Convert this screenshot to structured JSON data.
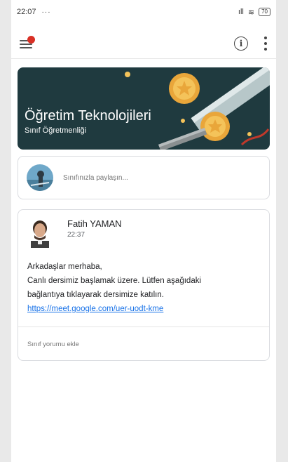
{
  "status_bar": {
    "time": "22:07",
    "dots": "···",
    "signal": "ıll",
    "wifi": "≋",
    "battery": "70"
  },
  "icons": {
    "menu": "hamburger-menu-icon",
    "info": "info-icon",
    "more": "more-vert-icon",
    "notification_color": "#d93025"
  },
  "banner": {
    "title": "Öğretim Teknolojileri",
    "subtitle": "Sınıf Öğretmenliği",
    "background": "#1f3a3f"
  },
  "share": {
    "placeholder": "Sınıfınızla paylaşın..."
  },
  "post": {
    "author": "Fatih YAMAN",
    "time": "22:37",
    "lines": [
      "Arkadaşlar merhaba,",
      "Canlı dersimiz başlamak üzere. Lütfen aşağıdaki",
      "bağlantıya tıklayarak dersimize katılın."
    ],
    "link": "https://meet.google.com/uer-uodt-kme",
    "link_color": "#1a73e8",
    "add_comment": "Sınıf yorumu ekle"
  }
}
